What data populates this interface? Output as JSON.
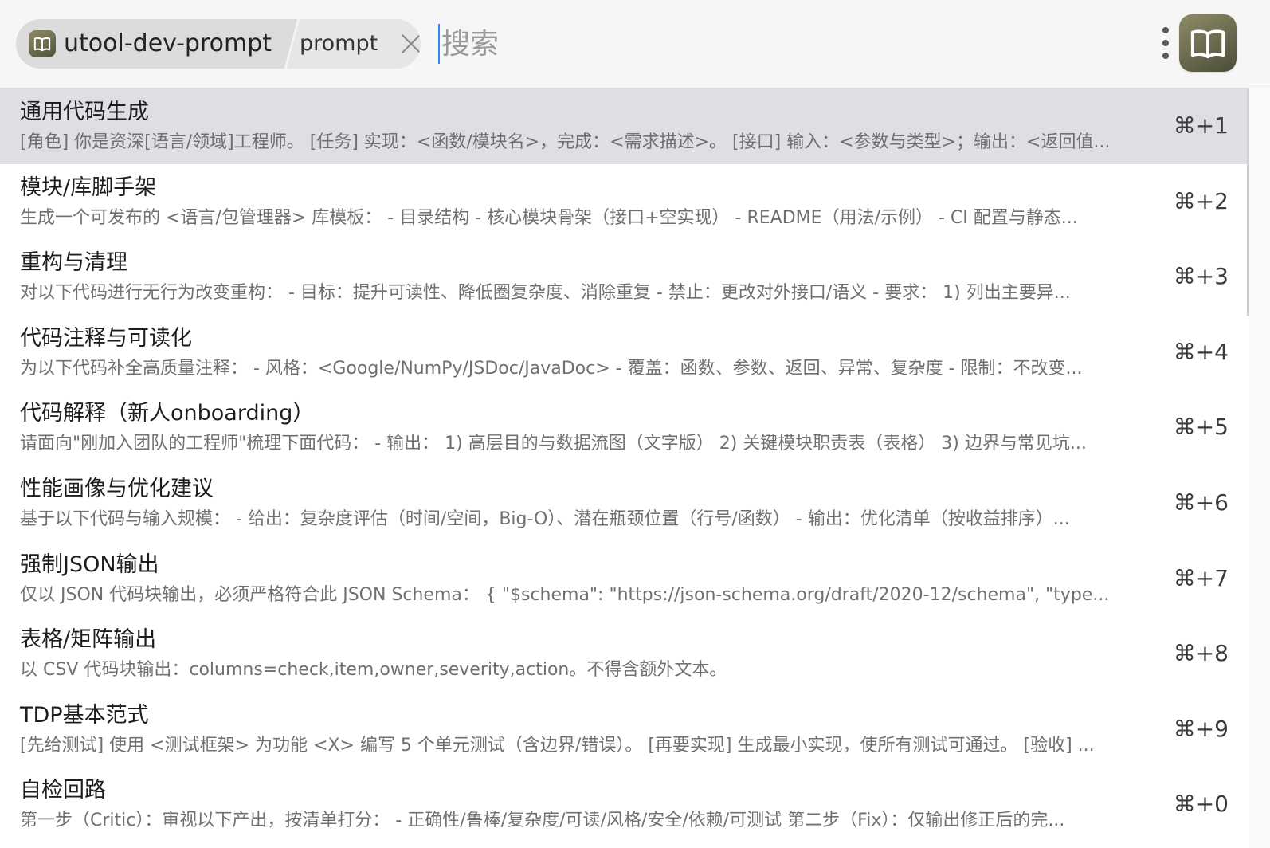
{
  "header": {
    "plugin_name": "utool-dev-prompt",
    "plugin_icon": "book-icon",
    "subcommand": "prompt",
    "search_placeholder": "搜索",
    "search_value": "",
    "app_icon": "book-icon"
  },
  "list": {
    "selected_index": 0,
    "items": [
      {
        "title": "通用代码生成",
        "description": "[角色] 你是资深[语言/领域]工程师。 [任务] 实现：<函数/模块名>，完成：<需求描述>。 [接口] 输入：<参数与类型>；输出：<返回值...",
        "shortcut": "⌘+1"
      },
      {
        "title": "模块/库脚手架",
        "description": "生成一个可发布的 <语言/包管理器> 库模板： - 目录结构 - 核心模块骨架（接口+空实现） - README（用法/示例） - CI 配置与静态...",
        "shortcut": "⌘+2"
      },
      {
        "title": "重构与清理",
        "description": "对以下代码进行无行为改变重构： - 目标：提升可读性、降低圈复杂度、消除重复 - 禁止：更改对外接口/语义 - 要求： 1) 列出主要异...",
        "shortcut": "⌘+3"
      },
      {
        "title": "代码注释与可读化",
        "description": "为以下代码补全高质量注释： - 风格：<Google/NumPy/JSDoc/JavaDoc> - 覆盖：函数、参数、返回、异常、复杂度 - 限制：不改变...",
        "shortcut": "⌘+4"
      },
      {
        "title": "代码解释（新人onboarding）",
        "description": "请面向\"刚加入团队的工程师\"梳理下面代码： - 输出： 1) 高层目的与数据流图（文字版） 2) 关键模块职责表（表格） 3) 边界与常见坑...",
        "shortcut": "⌘+5"
      },
      {
        "title": "性能画像与优化建议",
        "description": "基于以下代码与输入规模： - 给出：复杂度评估（时间/空间，Big-O）、潜在瓶颈位置（行号/函数） - 输出：优化清单（按收益排序）...",
        "shortcut": "⌘+6"
      },
      {
        "title": "强制JSON输出",
        "description": "仅以 JSON 代码块输出，必须严格符合此 JSON Schema： { \"$schema\": \"https://json-schema.org/draft/2020-12/schema\", \"type...",
        "shortcut": "⌘+7"
      },
      {
        "title": "表格/矩阵输出",
        "description": "以 CSV 代码块输出：columns=check,item,owner,severity,action。不得含额外文本。",
        "shortcut": "⌘+8"
      },
      {
        "title": "TDP基本范式",
        "description": "[先给测试] 使用 <测试框架> 为功能 <X> 编写 5 个单元测试（含边界/错误）。 [再要实现] 生成最小实现，使所有测试可通过。 [验收] ...",
        "shortcut": "⌘+9"
      },
      {
        "title": "自检回路",
        "description": "第一步（Critic）：审视以下产出，按清单打分： - 正确性/鲁棒/复杂度/可读/风格/安全/依赖/可测试 第二步（Fix）：仅输出修正后的完...",
        "shortcut": "⌘+0"
      }
    ]
  },
  "colors": {
    "header_bg": "#f6f6f6",
    "pill_bg": "#e6e6e6",
    "selected_row_bg": "#dedfe2",
    "caret": "#3b82f6",
    "icon_olive": "#6e6c4f"
  }
}
